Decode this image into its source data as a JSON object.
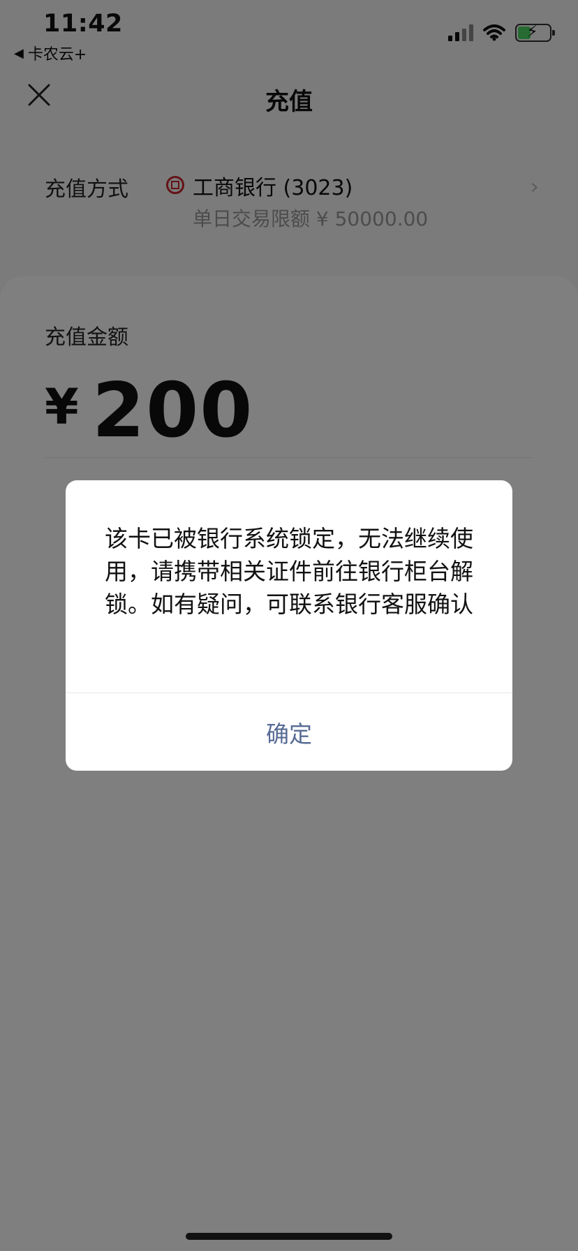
{
  "status_bar": {
    "time": "11:42",
    "back_app": "卡农云+",
    "icons": [
      "signal-icon",
      "wifi-icon",
      "battery-charging-icon"
    ]
  },
  "nav": {
    "title": "充值",
    "close_icon": "close-icon"
  },
  "payment": {
    "label": "充值方式",
    "bank_icon": "icbc-logo-icon",
    "bank_name": "工商银行 (3023)",
    "limit_text": "单日交易限额 ¥ 50000.00"
  },
  "amount": {
    "label": "充值金额",
    "currency": "¥",
    "value": "200"
  },
  "dialog": {
    "message": "该卡已被银行系统锁定，无法继续使用，请携带相关证件前往银行柜台解锁。如有疑问，可联系银行客服确认",
    "confirm_label": "确定"
  },
  "colors": {
    "dialog_button": "#576b95",
    "overlay": "rgba(0,0,0,0.5)",
    "bank_red": "#c8262c",
    "battery_green": "#4cd964"
  }
}
